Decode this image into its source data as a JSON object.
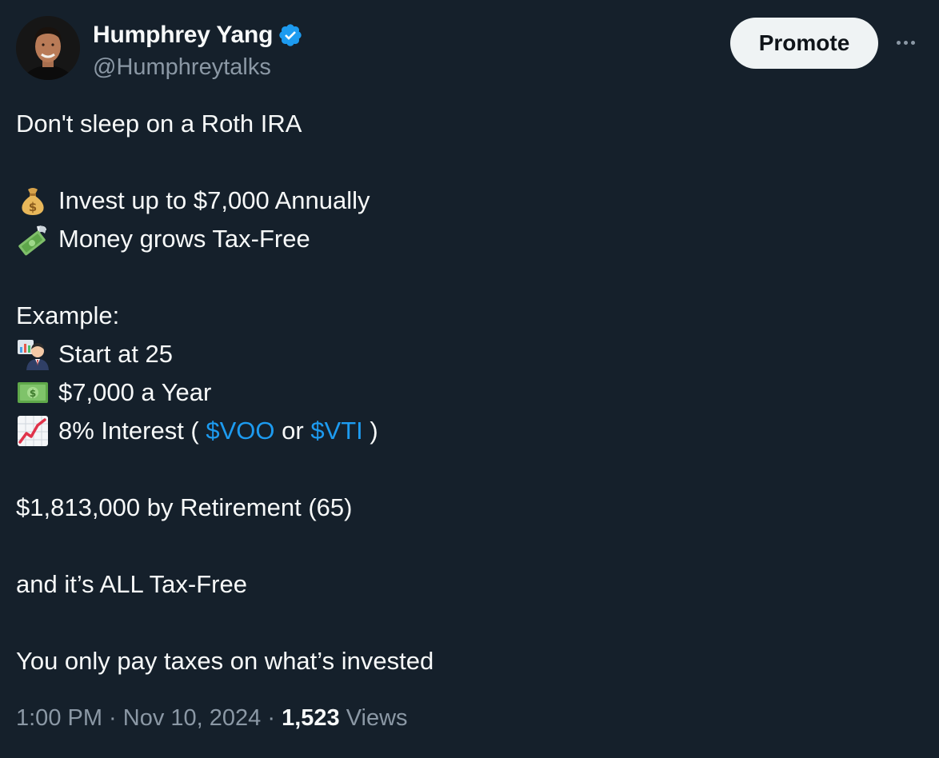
{
  "author": {
    "display_name": "Humphrey Yang",
    "handle": "@Humphreytalks",
    "verified_icon": "verified-badge-icon",
    "verified_color": "#1d9bf0"
  },
  "actions": {
    "promote_label": "Promote",
    "more_icon": "more-options-icon"
  },
  "tweet": {
    "line1": "Don't sleep on a Roth IRA",
    "line2": "Invest up to $7,000 Annually",
    "line2_icon": "money-bag-icon",
    "line3": "Money grows Tax-Free",
    "line3_icon": "money-with-wings-icon",
    "line4": "Example:",
    "line5": "Start at 25",
    "line5_icon": "office-worker-icon",
    "line6": "$7,000 a Year",
    "line6_icon": "dollar-banknote-icon",
    "line7_prefix": "8% Interest ( ",
    "line7_icon": "chart-increasing-icon",
    "cashtag1": "$VOO",
    "line7_mid": " or ",
    "cashtag2": "$VTI",
    "line7_suffix": " )",
    "line8": "$1,813,000 by Retirement (65)",
    "line9": "and it’s ALL Tax-Free",
    "line10": "You only pay taxes on what’s invested",
    "link_color": "#1d9bf0"
  },
  "meta": {
    "time": "1:00 PM",
    "separator": " · ",
    "date": "Nov 10, 2024",
    "views_count": "1,523",
    "views_label": "Views"
  }
}
